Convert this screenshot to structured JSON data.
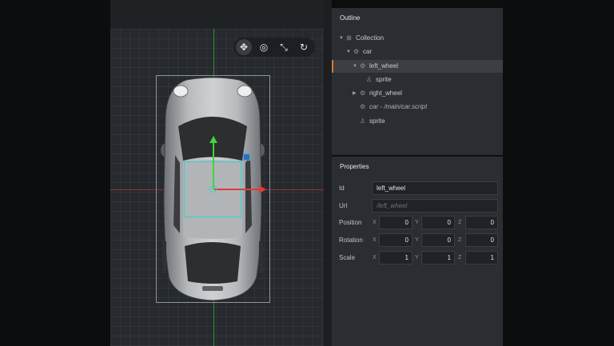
{
  "viewport": {
    "tools": [
      {
        "name": "move-tool",
        "glyph": "✥",
        "active": true
      },
      {
        "name": "rotate-tool",
        "glyph": "◎",
        "active": false
      },
      {
        "name": "scale-tool",
        "glyph": "⤡",
        "active": false
      },
      {
        "name": "toggle-tool",
        "glyph": "↻",
        "active": false
      }
    ]
  },
  "outline": {
    "title": "Outline",
    "items": [
      {
        "label": "Collection",
        "twisty": "▼",
        "icon": "⊞"
      },
      {
        "label": "car",
        "twisty": "▼",
        "icon": "⚙"
      },
      {
        "label": "left_wheel",
        "twisty": "▼",
        "icon": "⚙"
      },
      {
        "label": "sprite",
        "twisty": "",
        "icon": "♙"
      },
      {
        "label": "right_wheel",
        "twisty": "▶",
        "icon": "⚙"
      },
      {
        "label": "car - /main/car.script",
        "twisty": "",
        "icon": "⚙"
      },
      {
        "label": "sprite",
        "twisty": "",
        "icon": "♙"
      }
    ]
  },
  "properties": {
    "title": "Properties",
    "id": {
      "label": "Id",
      "value": "left_wheel"
    },
    "url": {
      "label": "Url",
      "value": "/left_wheel"
    },
    "position": {
      "label": "Position",
      "x": "0",
      "y": "0",
      "z": "0"
    },
    "rotation": {
      "label": "Rotation",
      "x": "0",
      "y": "0",
      "z": "0"
    },
    "scale": {
      "label": "Scale",
      "x": "1",
      "y": "1",
      "z": "1"
    },
    "axis_letters": {
      "x": "X",
      "y": "Y",
      "z": "Z"
    }
  },
  "colors": {
    "selection_accent": "#e0772a",
    "axis_x": "#e23a3a",
    "axis_y": "#3dd63d",
    "selection_box": "#2fd3d3"
  }
}
